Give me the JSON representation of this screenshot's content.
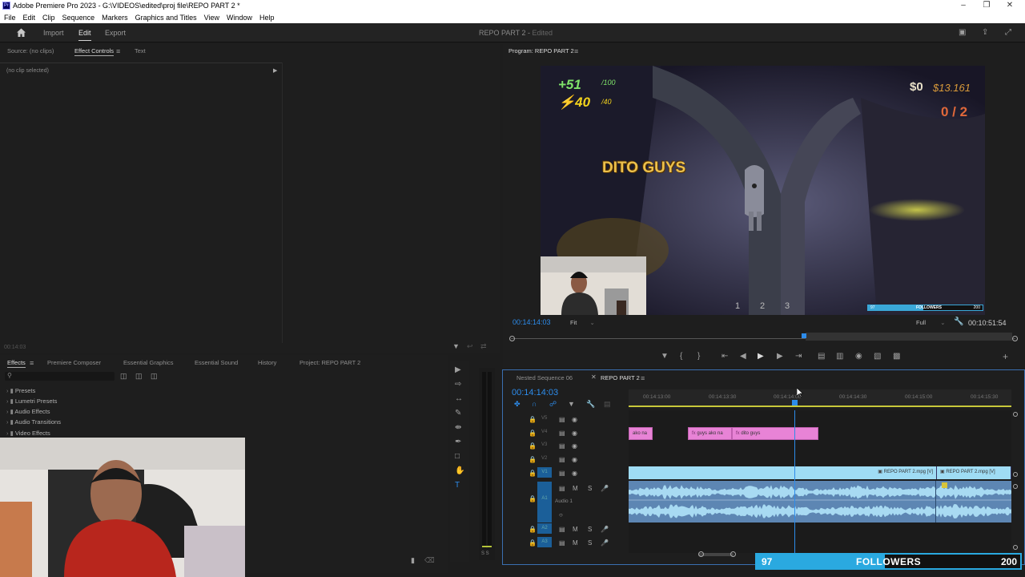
{
  "window": {
    "title": "Adobe Premiere Pro 2023 - G:\\VIDEOS\\edited\\proj file\\REPO PART 2 *",
    "app_icon": "Pr"
  },
  "menu": [
    "File",
    "Edit",
    "Clip",
    "Sequence",
    "Markers",
    "Graphics and Titles",
    "View",
    "Window",
    "Help"
  ],
  "workspaces": {
    "import": "Import",
    "edit": "Edit",
    "export": "Export",
    "doc_title": "REPO PART 2",
    "doc_status": "Edited"
  },
  "source_panel": {
    "tabs": [
      "Source: (no clips)",
      "Effect Controls",
      "Text"
    ],
    "no_clip": "(no clip selected)",
    "timecode": "00:14:03"
  },
  "effects_panel": {
    "tabs": [
      "Effects",
      "Premiere Composer",
      "Essential Graphics",
      "Essential Sound",
      "History",
      "Project: REPO PART 2"
    ],
    "folders": [
      "Presets",
      "Lumetri Presets",
      "Audio Effects",
      "Audio Transitions",
      "Video Effects"
    ]
  },
  "program": {
    "title": "Program: REPO PART 2",
    "timecode": "00:14:14:03",
    "fit": "Fit",
    "quality": "Full",
    "duration": "00:10:51:54"
  },
  "game_overlay": {
    "health": "+51",
    "health_max": "/100",
    "stamina": "40",
    "stamina_max": "/40",
    "money": "$0",
    "money_goal": "$13.161",
    "count": "0 / 2",
    "caption": "DITO GUYS",
    "slots": [
      "1",
      "2",
      "3"
    ],
    "followers_small": {
      "current": "97",
      "label": "FOLLOWERS",
      "goal": "200"
    }
  },
  "timeline": {
    "tabs": [
      "Nested Sequence 06",
      "REPO PART 2"
    ],
    "timecode": "00:14:14:03",
    "ruler": [
      "00:14:13:00",
      "00:14:13:30",
      "00:14:14:00",
      "00:14:14:30",
      "00:14:15:00",
      "00:14:15:30"
    ],
    "tracks_video": [
      "V5",
      "V4",
      "V3",
      "V2",
      "V1"
    ],
    "tracks_audio": [
      "A1",
      "A2",
      "A3"
    ],
    "audio_label": "Audio 1",
    "clips_v4": [
      "ako na",
      "guys ako na",
      "dito guys"
    ],
    "clips_v1": [
      "REPO PART 2.mpg [V]",
      "REPO PART 2.mpg [V]"
    ],
    "fx_badge": "fx"
  },
  "followers_bar": {
    "current": "97",
    "label": "FOLLOWERS",
    "goal": "200",
    "progress": 0.485
  },
  "colors": {
    "accent": "#2d8ceb",
    "pink_clip": "#e883d6",
    "video_clip": "#9fdcf4",
    "audio_clip": "#5d86b3"
  }
}
